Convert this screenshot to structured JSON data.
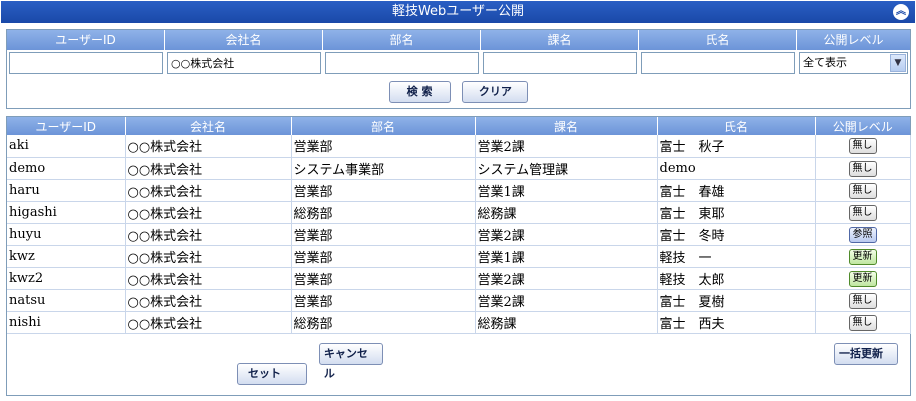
{
  "window": {
    "title": "軽技Webユーザー公開"
  },
  "search": {
    "headers": [
      "ユーザーID",
      "会社名",
      "部名",
      "課名",
      "氏名",
      "公開レベル"
    ],
    "values": [
      "",
      "○○株式会社",
      "",
      "",
      "",
      ""
    ],
    "level_selected": "全て表示",
    "search_label": "検 索",
    "clear_label": "クリア"
  },
  "list": {
    "headers": [
      "ユーザーID",
      "会社名",
      "部名",
      "課名",
      "氏名",
      "公開レベル"
    ],
    "rows": [
      {
        "id": "aki",
        "company": "○○株式会社",
        "dept": "営業部",
        "section": "営業2課",
        "name": "富士　秋子",
        "level": "無し"
      },
      {
        "id": "demo",
        "company": "○○株式会社",
        "dept": "システム事業部",
        "section": "システム管理課",
        "name": "demo",
        "level": "無し"
      },
      {
        "id": "haru",
        "company": "○○株式会社",
        "dept": "営業部",
        "section": "営業1課",
        "name": "富士　春雄",
        "level": "無し"
      },
      {
        "id": "higashi",
        "company": "○○株式会社",
        "dept": "総務部",
        "section": "総務課",
        "name": "富士　東耶",
        "level": "無し"
      },
      {
        "id": "huyu",
        "company": "○○株式会社",
        "dept": "営業部",
        "section": "営業2課",
        "name": "富士　冬時",
        "level": "参照"
      },
      {
        "id": "kwz",
        "company": "○○株式会社",
        "dept": "営業部",
        "section": "営業1課",
        "name": "軽技　一",
        "level": "更新"
      },
      {
        "id": "kwz2",
        "company": "○○株式会社",
        "dept": "営業部",
        "section": "営業2課",
        "name": "軽技　太郎",
        "level": "更新"
      },
      {
        "id": "natsu",
        "company": "○○株式会社",
        "dept": "営業部",
        "section": "営業2課",
        "name": "富士　夏樹",
        "level": "無し"
      },
      {
        "id": "nishi",
        "company": "○○株式会社",
        "dept": "総務部",
        "section": "総務課",
        "name": "富士　西夫",
        "level": "無し"
      }
    ],
    "set_label": "セット",
    "cancel_label": "キャンセル",
    "bulk_update_label": "一括更新"
  }
}
